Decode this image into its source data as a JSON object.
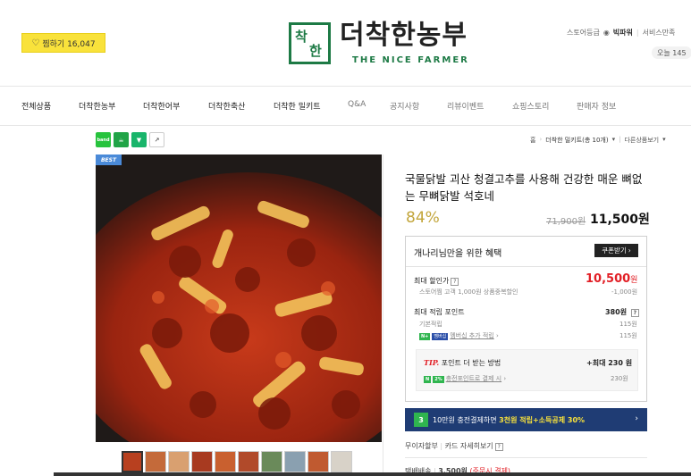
{
  "header": {
    "favorite_label": "찜하기 16,047",
    "logo_kr": "더착한농부",
    "logo_en": "THE NICE FARMER",
    "logo_mark_chars": [
      "착",
      "한"
    ],
    "store_grade_label": "스토어등급",
    "store_grade": "빅파워",
    "service": "서비스만족",
    "today": "오늘 145"
  },
  "nav": {
    "items": [
      "전체상품",
      "더착한농부",
      "더착한어부",
      "더착한축산",
      "더착한 밀키트",
      "Q&A",
      "공지사항",
      "리뷰이벤트",
      "쇼핑스토리",
      "판매자 정보"
    ]
  },
  "breadcrumb": {
    "home": "홈",
    "category": "더착한 밀키트(총 10개)",
    "other": "다른상품보기"
  },
  "share": {
    "band": "band",
    "url": "↗"
  },
  "badge": "BEST",
  "product": {
    "title": "국물닭발 괴산 청결고추를 사용해 건강한 매운 뼈없는 무뼈닭발 석호네",
    "discount": "84%",
    "original_price": "71,900원",
    "price": "11,500원"
  },
  "benefit": {
    "heading": "개나리님만을 위한 혜택",
    "coupon_label": "쿠폰받기",
    "max_discount_label": "최대 할인가",
    "max_discount_price": "10,500",
    "won": "원",
    "store_coupon": "스토어찜 고객 1,000원 상품중복할인",
    "store_coupon_amount": "-1,000원",
    "max_point_label": "최대 적립 포인트",
    "max_point": "380원",
    "basic_point_label": "기본적립",
    "basic_point": "115원",
    "membership_point_label": "멤버십 추가 적립",
    "membership_point": "115원",
    "npay": "N+",
    "membership_badge": "멤버십",
    "tip_label": "TIP.",
    "tip_text": "포인트 더 받는 방법",
    "tip_max": "+최대 230 원",
    "charge_label": "충전포인트로 결제 시",
    "charge_amount": "230원",
    "npay_pct": "2%"
  },
  "banner": {
    "badge": "3",
    "text_pre": "10만원 충전결제하면",
    "text_hl1": "3천원 적립",
    "text_plus": "+",
    "text_hl2": "소득공제 30%"
  },
  "interest": {
    "label": "무이자할부",
    "sep": "|",
    "detail": "카드 자세히보기"
  },
  "shipping": {
    "label": "택배배송",
    "sep": "|",
    "amount": "3,500원",
    "note": "(주문시 결제)"
  }
}
